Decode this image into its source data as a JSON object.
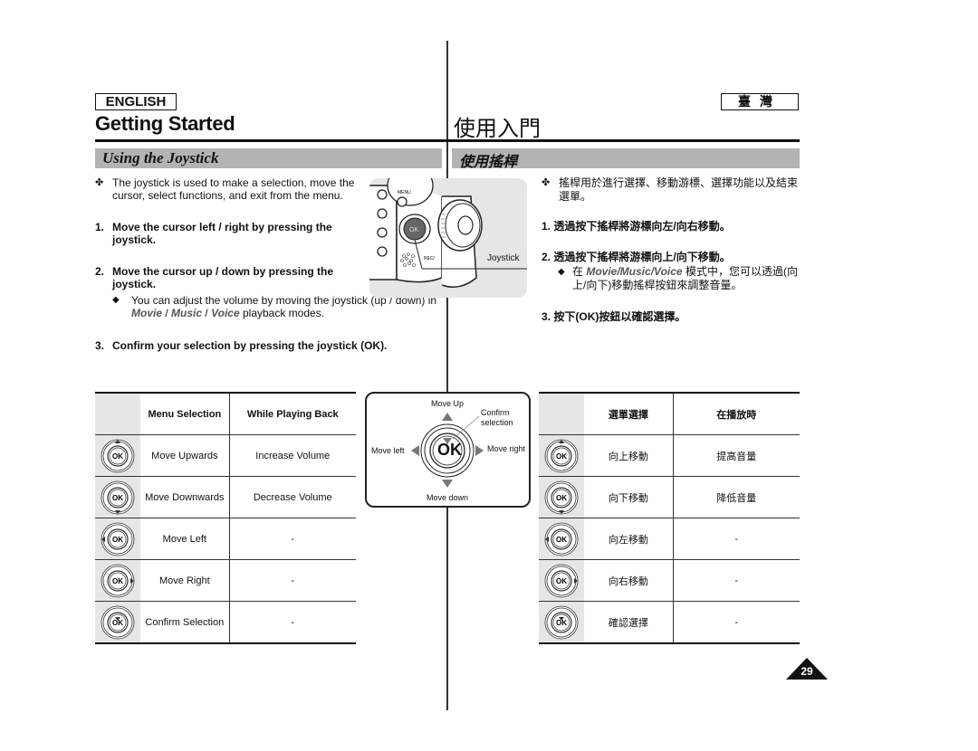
{
  "header": {
    "lang_en": "ENGLISH",
    "lang_tw": "臺灣",
    "title_en": "Getting Started",
    "title_tw": "使用入門",
    "section_en": "Using the Joystick",
    "section_tw": "使用搖桿"
  },
  "english": {
    "intro_bullet": "✤",
    "intro": "The joystick is used to make a selection, move the cursor, select functions, and exit from the menu.",
    "steps": [
      {
        "num": "1.",
        "text": "Move the cursor left / right by pressing the joystick."
      },
      {
        "num": "2.",
        "text": "Move the cursor up / down by pressing the joystick."
      },
      {
        "num": "3.",
        "text": "Confirm your selection by pressing the joystick (OK)."
      }
    ],
    "note": {
      "bullet": "◆",
      "prefix": "You can adjust the volume by moving the joystick (up / down) in ",
      "modes": [
        "Movie",
        "Music",
        "Voice"
      ],
      "separator": " / ",
      "suffix": " playback modes."
    }
  },
  "illustration": {
    "joystick_label": "Joystick",
    "button_ok": "OK",
    "button_menu": "MENU",
    "button_rec": "REC/"
  },
  "chinese": {
    "intro_bullet": "✤",
    "intro": "搖桿用於進行選擇、移動游標、選擇功能以及結束選單。",
    "steps": [
      {
        "num": "1.",
        "text": "透過按下搖桿將游標向左/向右移動。"
      },
      {
        "num": "2.",
        "text": "透過按下搖桿將游標向上/向下移動。"
      },
      {
        "num": "3.",
        "text": "按下(OK)按鈕以確認選擇。"
      }
    ],
    "note": {
      "bullet": "◆",
      "prefix": "在 ",
      "modes": "Movie/Music/Voice",
      "suffix": " 模式中，您可以透過(向上/向下)移動搖桿按鈕來調整音量。"
    }
  },
  "diagram": {
    "move_up": "Move Up",
    "move_down": "Move down",
    "move_left": "Move left",
    "move_right": "Move right",
    "confirm": "Confirm selection",
    "ok": "OK"
  },
  "table_en": {
    "headers": [
      "",
      "Menu Selection",
      "While Playing Back"
    ],
    "rows": [
      {
        "icon": "joystick-up-icon",
        "menu": "Move Upwards",
        "playback": "Increase Volume"
      },
      {
        "icon": "joystick-down-icon",
        "menu": "Move Downwards",
        "playback": "Decrease Volume"
      },
      {
        "icon": "joystick-left-icon",
        "menu": "Move Left",
        "playback": "-"
      },
      {
        "icon": "joystick-right-icon",
        "menu": "Move Right",
        "playback": "-"
      },
      {
        "icon": "joystick-press-icon",
        "menu": "Confirm Selection",
        "playback": "-"
      }
    ]
  },
  "table_tw": {
    "headers": [
      "",
      "選單選擇",
      "在播放時"
    ],
    "rows": [
      {
        "icon": "joystick-up-icon",
        "menu": "向上移動",
        "playback": "提高音量"
      },
      {
        "icon": "joystick-down-icon",
        "menu": "向下移動",
        "playback": "降低音量"
      },
      {
        "icon": "joystick-left-icon",
        "menu": "向左移動",
        "playback": "-"
      },
      {
        "icon": "joystick-right-icon",
        "menu": "向右移動",
        "playback": "-"
      },
      {
        "icon": "joystick-press-icon",
        "menu": "確認選擇",
        "playback": "-"
      }
    ]
  },
  "page_number": "29",
  "colors": {
    "section_band": "#b3b3b3",
    "icon_cell": "#e6e6e6",
    "mode_text": "#555555"
  }
}
